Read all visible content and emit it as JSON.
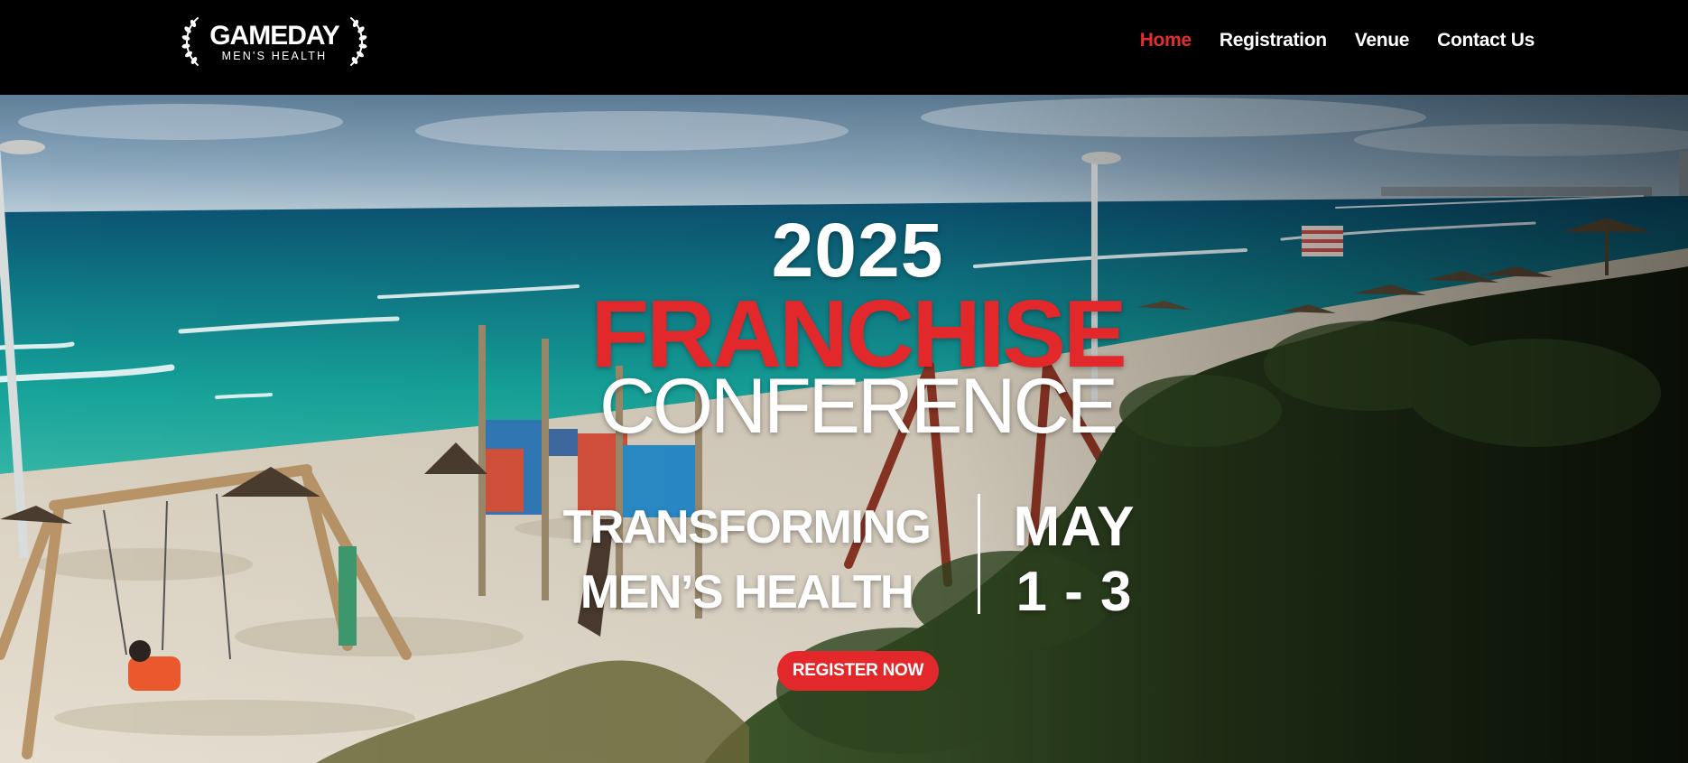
{
  "brand": {
    "logo_main": "GAMEDAY",
    "logo_sub": "MEN'S HEALTH"
  },
  "nav": {
    "items": [
      {
        "label": "Home",
        "active": true
      },
      {
        "label": "Registration",
        "active": false
      },
      {
        "label": "Venue",
        "active": false
      },
      {
        "label": "Contact Us",
        "active": false
      }
    ]
  },
  "hero": {
    "year": "2025",
    "title": "FRANCHISE",
    "subtitle": "CONFERENCE",
    "tagline_line1": "TRANSFORMING",
    "tagline_line2": "MEN’S HEALTH",
    "date_line1": "MAY",
    "date_line2": "1 - 3",
    "cta_label": "REGISTER NOW"
  },
  "colors": {
    "accent": "#e3282c",
    "nav_active": "#e02f31",
    "header_bg": "#000000",
    "text": "#ffffff"
  }
}
